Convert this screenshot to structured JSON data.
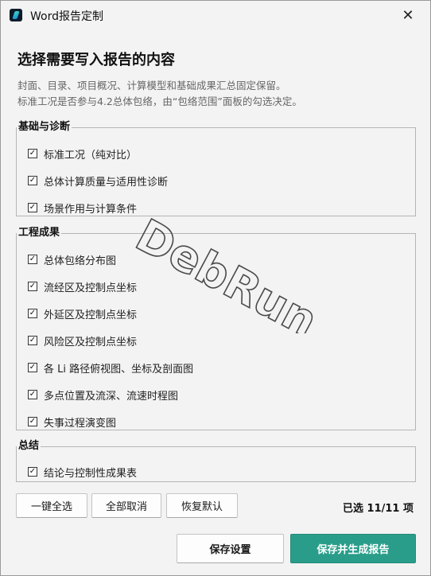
{
  "window": {
    "title": "Word报告定制",
    "close_glyph": "✕"
  },
  "heading": "选择需要写入报告的内容",
  "description": [
    "封面、目录、项目概况、计算模型和基础成果汇总固定保留。",
    "标准工况是否参与4.2总体包络，由“包络范围”面板的勾选决定。"
  ],
  "groups": [
    {
      "title": "基础与诊断",
      "items": [
        {
          "label": "标准工况（纯对比）",
          "checked": true
        },
        {
          "label": "总体计算质量与适用性诊断",
          "checked": true
        },
        {
          "label": "场景作用与计算条件",
          "checked": true
        }
      ]
    },
    {
      "title": "工程成果",
      "items": [
        {
          "label": "总体包络分布图",
          "checked": true
        },
        {
          "label": "流经区及控制点坐标",
          "checked": true
        },
        {
          "label": "外延区及控制点坐标",
          "checked": true
        },
        {
          "label": "风险区及控制点坐标",
          "checked": true
        },
        {
          "label": "各 Li 路径俯视图、坐标及剖面图",
          "checked": true
        },
        {
          "label": "多点位置及流深、流速时程图",
          "checked": true
        },
        {
          "label": "失事过程演变图",
          "checked": true
        }
      ]
    },
    {
      "title": "总结",
      "items": [
        {
          "label": "结论与控制性成果表",
          "checked": true
        }
      ]
    }
  ],
  "check_glyph": "✓",
  "buttons": {
    "select_all": "一键全选",
    "clear_all": "全部取消",
    "restore_default": "恢复默认",
    "save_settings": "保存设置",
    "save_and_generate": "保存并生成报告"
  },
  "selection_count": "已选 11/11 项",
  "watermark": "DebRun",
  "colors": {
    "primary": "#2a9d8a",
    "background": "#f3f3f3"
  }
}
